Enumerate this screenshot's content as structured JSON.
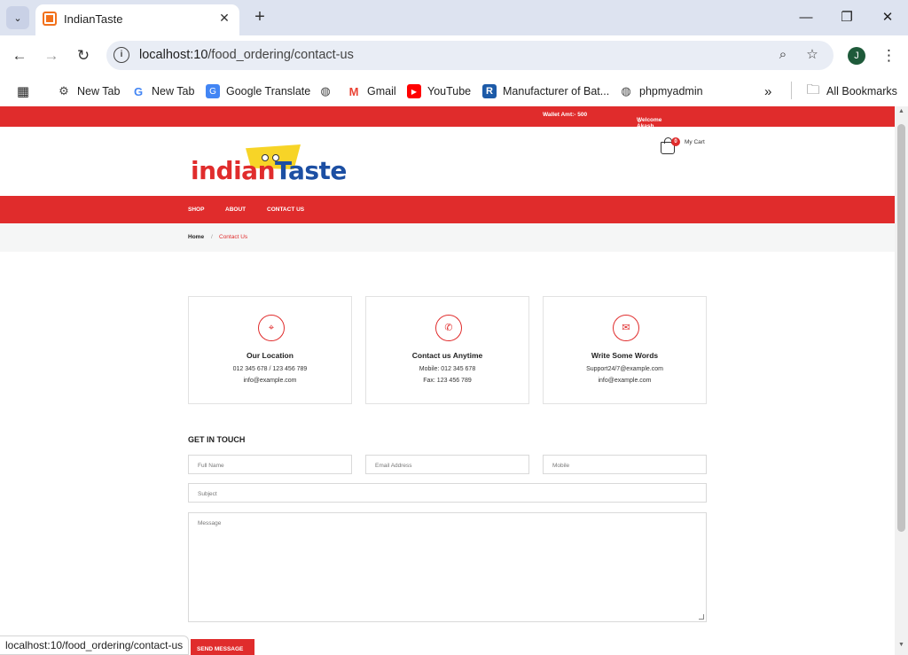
{
  "browser": {
    "tab_title": "IndianTaste",
    "tab_close_glyph": "✕",
    "new_tab_glyph": "+",
    "url_host": "localhost:10",
    "url_path": "/food_ordering/contact-us",
    "profile_initial": "J",
    "bookmarks": [
      {
        "label": "New Tab",
        "icon": "gear-icon"
      },
      {
        "label": "New Tab",
        "icon": "google-icon"
      },
      {
        "label": "Google Translate",
        "icon": "translate-icon"
      },
      {
        "label": "",
        "icon": "globe-icon"
      },
      {
        "label": "Gmail",
        "icon": "gmail-icon"
      },
      {
        "label": "YouTube",
        "icon": "youtube-icon"
      },
      {
        "label": "Manufacturer of Bat...",
        "icon": "r-icon"
      },
      {
        "label": "phpmyadmin",
        "icon": "globe-icon"
      }
    ],
    "more_bookmarks_glyph": "»",
    "all_bookmarks_label": "All Bookmarks",
    "status_url": "localhost:10/food_ordering/contact-us"
  },
  "topbar": {
    "wallet": "Wallet Amt:- 500",
    "welcome": "Welcome Akash joshi"
  },
  "brand": {
    "part1": "indian",
    "part2": "Taste"
  },
  "cart": {
    "count": "0",
    "label": "My Cart"
  },
  "nav": {
    "items": [
      "SHOP",
      "ABOUT",
      "CONTACT US"
    ]
  },
  "breadcrumb": {
    "home": "Home",
    "separator": "/",
    "current": "Contact Us"
  },
  "contact_cards": [
    {
      "title": "Our Location",
      "line1": "012 345 678 / 123 456 789",
      "line2": "info@example.com",
      "icon": "map-pin-icon"
    },
    {
      "title": "Contact us Anytime",
      "line1": "Mobile: 012 345 678",
      "line2": "Fax: 123 456 789",
      "icon": "phone-icon"
    },
    {
      "title": "Write Some Words",
      "line1": "Support24/7@example.com",
      "line2": "info@example.com",
      "icon": "envelope-icon"
    }
  ],
  "form": {
    "title": "GET IN TOUCH",
    "full_name_placeholder": "Full Name",
    "email_placeholder": "Email Address",
    "mobile_placeholder": "Mobile",
    "subject_placeholder": "Subject",
    "message_placeholder": "Message",
    "submit_label": "SEND MESSAGE"
  },
  "colors": {
    "brand_red": "#e02c2c",
    "brand_blue": "#1c4fa3",
    "brand_yellow": "#f7d427"
  }
}
